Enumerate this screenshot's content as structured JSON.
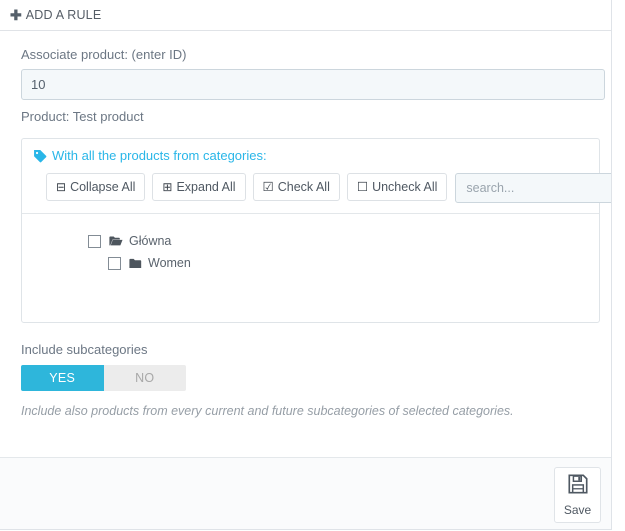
{
  "panel": {
    "title": "ADD A RULE",
    "plus_icon": "plus-icon"
  },
  "form": {
    "associate_label": "Associate product: (enter ID)",
    "product_id_value": "10",
    "product_note": "Product: Test product"
  },
  "categories": {
    "title": "With all the products from categories:",
    "tag_icon": "tag-icon",
    "buttons": {
      "collapse_all": "Collapse All",
      "expand_all": "Expand All",
      "check_all": "Check All",
      "uncheck_all": "Uncheck All"
    },
    "search_placeholder": "search...",
    "tree": [
      {
        "label": "Główna",
        "icon": "folder-open-icon",
        "level": 0,
        "checked": false
      },
      {
        "label": "Women",
        "icon": "folder-closed-icon",
        "level": 1,
        "checked": false
      }
    ]
  },
  "subcategories": {
    "label": "Include subcategories",
    "toggle_yes": "YES",
    "toggle_no": "NO",
    "selected": "YES",
    "help": "Include also products from every current and future subcategories of selected categories."
  },
  "footer": {
    "save_label": "Save",
    "save_icon": "floppy-disk-icon"
  },
  "colors": {
    "accent": "#29b6e8",
    "toggle_on": "#2eb6db",
    "toggle_off": "#ececec",
    "panel_border": "#dfe3e8"
  }
}
